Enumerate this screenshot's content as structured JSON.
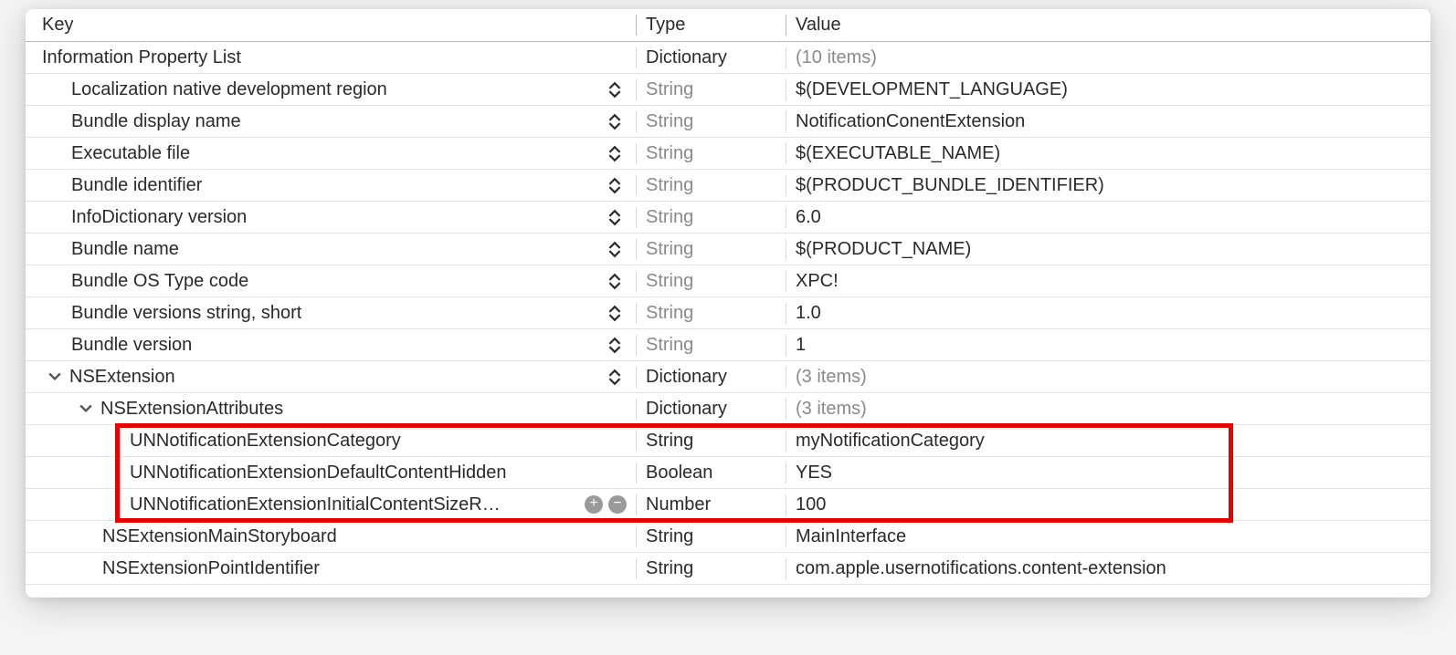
{
  "header": {
    "key": "Key",
    "type": "Type",
    "value": "Value"
  },
  "rows": [
    {
      "key": "Information Property List",
      "type": "Dictionary",
      "value": "(10 items)",
      "indent": 0,
      "greyType": false,
      "greyValue": true,
      "stepper": false,
      "disclosure": null
    },
    {
      "key": "Localization native development region",
      "type": "String",
      "value": "$(DEVELOPMENT_LANGUAGE)",
      "indent": 1,
      "greyType": true,
      "stepper": true
    },
    {
      "key": "Bundle display name",
      "type": "String",
      "value": "NotificationConentExtension",
      "indent": 1,
      "greyType": true,
      "stepper": true
    },
    {
      "key": "Executable file",
      "type": "String",
      "value": "$(EXECUTABLE_NAME)",
      "indent": 1,
      "greyType": true,
      "stepper": true
    },
    {
      "key": "Bundle identifier",
      "type": "String",
      "value": "$(PRODUCT_BUNDLE_IDENTIFIER)",
      "indent": 1,
      "greyType": true,
      "stepper": true
    },
    {
      "key": "InfoDictionary version",
      "type": "String",
      "value": "6.0",
      "indent": 1,
      "greyType": true,
      "stepper": true
    },
    {
      "key": "Bundle name",
      "type": "String",
      "value": "$(PRODUCT_NAME)",
      "indent": 1,
      "greyType": true,
      "stepper": true
    },
    {
      "key": "Bundle OS Type code",
      "type": "String",
      "value": "XPC!",
      "indent": 1,
      "greyType": true,
      "stepper": true
    },
    {
      "key": "Bundle versions string, short",
      "type": "String",
      "value": "1.0",
      "indent": 1,
      "greyType": true,
      "stepper": true
    },
    {
      "key": "Bundle version",
      "type": "String",
      "value": "1",
      "indent": 1,
      "greyType": true,
      "stepper": true
    },
    {
      "key": "NSExtension",
      "type": "Dictionary",
      "value": "(3 items)",
      "indent": 1,
      "greyType": false,
      "greyValue": true,
      "stepper": true,
      "disclosure": "open"
    },
    {
      "key": "NSExtensionAttributes",
      "type": "Dictionary",
      "value": "(3 items)",
      "indent": 2,
      "greyType": false,
      "greyValue": true,
      "stepper": false,
      "disclosure": "open"
    },
    {
      "key": "UNNotificationExtensionCategory",
      "type": "String",
      "value": "myNotificationCategory",
      "indent": 3,
      "greyType": false,
      "stepper": false
    },
    {
      "key": "UNNotificationExtensionDefaultContentHidden",
      "type": "Boolean",
      "value": "YES",
      "indent": 3,
      "greyType": false,
      "stepper": false
    },
    {
      "key": "UNNotificationExtensionInitialContentSizeR…",
      "type": "Number",
      "value": "100",
      "indent": 3,
      "greyType": false,
      "stepper": false,
      "addrm": true
    },
    {
      "key": "NSExtensionMainStoryboard",
      "type": "String",
      "value": "MainInterface",
      "indent": 2,
      "greyType": false,
      "stepper": false,
      "plain": true
    },
    {
      "key": "NSExtensionPointIdentifier",
      "type": "String",
      "value": "com.apple.usernotifications.content-extension",
      "indent": 2,
      "greyType": false,
      "stepper": false,
      "plain": true
    }
  ],
  "highlight": {
    "startRow": 12,
    "endRow": 14
  }
}
